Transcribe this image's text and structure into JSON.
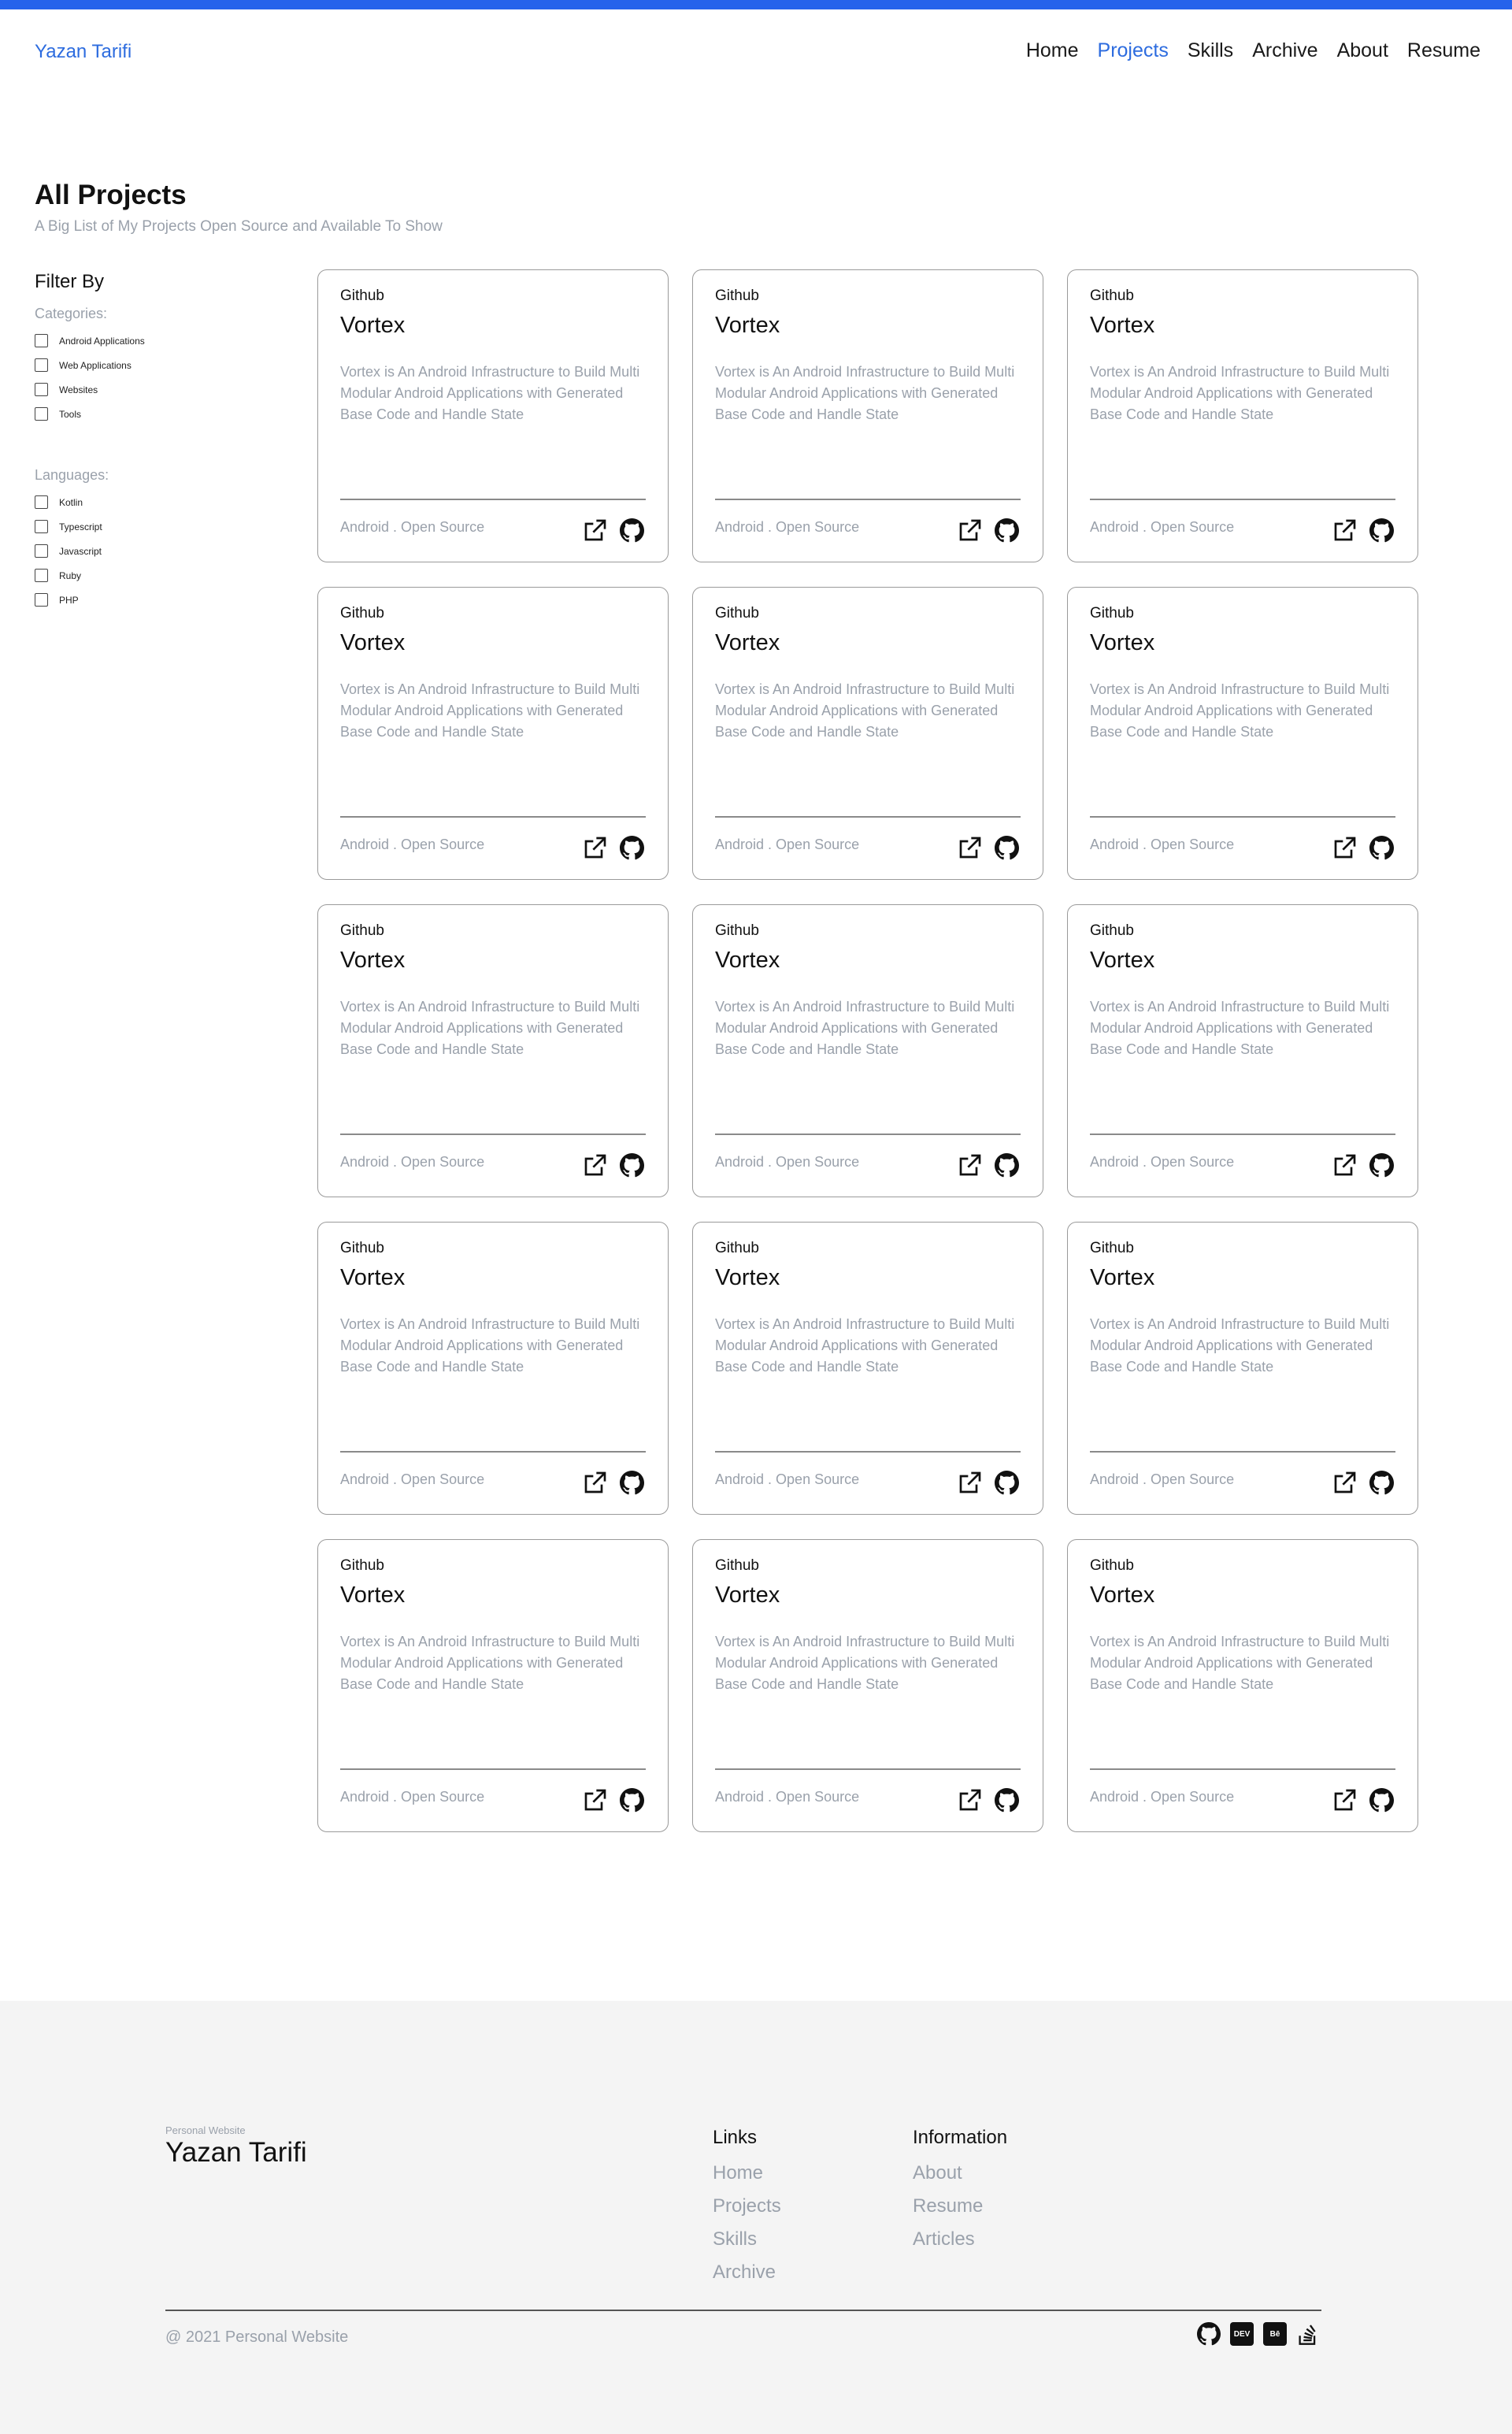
{
  "header": {
    "brand": "Yazan Tarifi",
    "nav": [
      {
        "label": "Home",
        "active": false
      },
      {
        "label": "Projects",
        "active": true
      },
      {
        "label": "Skills",
        "active": false
      },
      {
        "label": "Archive",
        "active": false
      },
      {
        "label": "About",
        "active": false
      },
      {
        "label": "Resume",
        "active": false
      }
    ]
  },
  "main": {
    "title": "All Projects",
    "subtitle": "A Big List of My Projects Open Source and Available To Show"
  },
  "filter": {
    "title": "Filter By",
    "categories_label": "Categories:",
    "categories": [
      "Android Applications",
      "Web Applications",
      "Websites",
      "Tools"
    ],
    "languages_label": "Languages:",
    "languages": [
      "Kotlin",
      "Typescript",
      "Javascript",
      "Ruby",
      "PHP"
    ]
  },
  "projects": [
    {
      "source": "Github",
      "name": "Vortex",
      "description": "Vortex is An Android Infrastructure to Build Multi Modular Android Applications with Generated Base Code and Handle State",
      "tags": "Android . Open Source"
    },
    {
      "source": "Github",
      "name": "Vortex",
      "description": "Vortex is An Android Infrastructure to Build Multi Modular Android Applications with Generated Base Code and Handle State",
      "tags": "Android . Open Source"
    },
    {
      "source": "Github",
      "name": "Vortex",
      "description": "Vortex is An Android Infrastructure to Build Multi Modular Android Applications with Generated Base Code and Handle State",
      "tags": "Android . Open Source"
    },
    {
      "source": "Github",
      "name": "Vortex",
      "description": "Vortex is An Android Infrastructure to Build Multi Modular Android Applications with Generated Base Code and Handle State",
      "tags": "Android . Open Source"
    },
    {
      "source": "Github",
      "name": "Vortex",
      "description": "Vortex is An Android Infrastructure to Build Multi Modular Android Applications with Generated Base Code and Handle State",
      "tags": "Android . Open Source"
    },
    {
      "source": "Github",
      "name": "Vortex",
      "description": "Vortex is An Android Infrastructure to Build Multi Modular Android Applications with Generated Base Code and Handle State",
      "tags": "Android . Open Source"
    },
    {
      "source": "Github",
      "name": "Vortex",
      "description": "Vortex is An Android Infrastructure to Build Multi Modular Android Applications with Generated Base Code and Handle State",
      "tags": "Android . Open Source"
    },
    {
      "source": "Github",
      "name": "Vortex",
      "description": "Vortex is An Android Infrastructure to Build Multi Modular Android Applications with Generated Base Code and Handle State",
      "tags": "Android . Open Source"
    },
    {
      "source": "Github",
      "name": "Vortex",
      "description": "Vortex is An Android Infrastructure to Build Multi Modular Android Applications with Generated Base Code and Handle State",
      "tags": "Android . Open Source"
    },
    {
      "source": "Github",
      "name": "Vortex",
      "description": "Vortex is An Android Infrastructure to Build Multi Modular Android Applications with Generated Base Code and Handle State",
      "tags": "Android . Open Source"
    },
    {
      "source": "Github",
      "name": "Vortex",
      "description": "Vortex is An Android Infrastructure to Build Multi Modular Android Applications with Generated Base Code and Handle State",
      "tags": "Android . Open Source"
    },
    {
      "source": "Github",
      "name": "Vortex",
      "description": "Vortex is An Android Infrastructure to Build Multi Modular Android Applications with Generated Base Code and Handle State",
      "tags": "Android . Open Source"
    },
    {
      "source": "Github",
      "name": "Vortex",
      "description": "Vortex is An Android Infrastructure to Build Multi Modular Android Applications with Generated Base Code and Handle State",
      "tags": "Android . Open Source"
    },
    {
      "source": "Github",
      "name": "Vortex",
      "description": "Vortex is An Android Infrastructure to Build Multi Modular Android Applications with Generated Base Code and Handle State",
      "tags": "Android . Open Source"
    },
    {
      "source": "Github",
      "name": "Vortex",
      "description": "Vortex is An Android Infrastructure to Build Multi Modular Android Applications with Generated Base Code and Handle State",
      "tags": "Android . Open Source"
    }
  ],
  "footer": {
    "small": "Personal Website",
    "name": "Yazan Tarifi",
    "links_head": "Links",
    "links": [
      "Home",
      "Projects",
      "Skills",
      "Archive"
    ],
    "info_head": "Information",
    "info": [
      "About",
      "Resume",
      "Articles"
    ],
    "copyright": "@ 2021 Personal Website",
    "social": [
      {
        "icon": "github-icon"
      },
      {
        "icon": "dev-icon",
        "text": "DEV"
      },
      {
        "icon": "behance-icon",
        "text": "Bē"
      },
      {
        "icon": "stackoverflow-icon"
      }
    ]
  },
  "colors": {
    "accent": "#2563eb",
    "link": "#2d6cdf",
    "muted": "#9aa1ab",
    "footer_bg": "#f4f4f4"
  }
}
